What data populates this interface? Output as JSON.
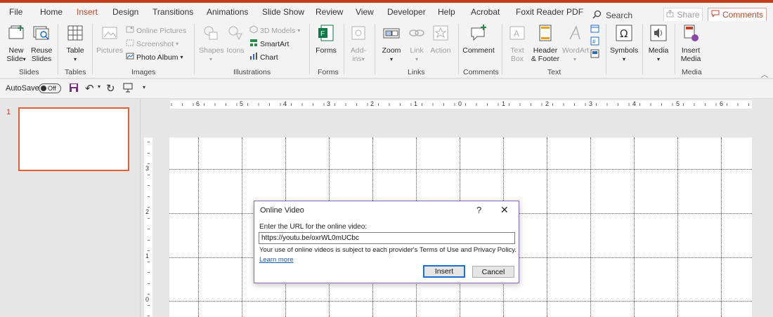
{
  "menu": {
    "tabs": [
      "File",
      "Home",
      "Insert",
      "Design",
      "Transitions",
      "Animations",
      "Slide Show",
      "Review",
      "View",
      "Developer",
      "Help",
      "Acrobat",
      "Foxit Reader PDF"
    ],
    "active_tab": "Insert",
    "search_label": "Search",
    "share_label": "Share",
    "comments_label": "Comments"
  },
  "ribbon": {
    "slides": {
      "new_slide": "New\nSlide",
      "new_slide_arrow": "▾",
      "reuse_slides": "Reuse\nSlides",
      "group": "Slides"
    },
    "tables": {
      "table": "Table",
      "group": "Tables"
    },
    "images": {
      "pictures": "Pictures",
      "online_pictures": "Online Pictures",
      "screenshot": "Screenshot",
      "photo_album": "Photo Album",
      "group": "Images"
    },
    "illustrations": {
      "shapes": "Shapes",
      "icons": "Icons",
      "models_3d": "3D Models",
      "smartart": "SmartArt",
      "chart": "Chart",
      "group": "Illustrations"
    },
    "forms": {
      "forms": "Forms",
      "group": "Forms"
    },
    "addins": {
      "addins": "Add-\nins"
    },
    "links": {
      "zoom": "Zoom",
      "link": "Link",
      "action": "Action",
      "group": "Links"
    },
    "comments": {
      "comment": "Comment",
      "group": "Comments"
    },
    "text": {
      "text_box": "Text\nBox",
      "header_footer": "Header\n& Footer",
      "wordart": "WordArt",
      "group": "Text"
    },
    "symbols": {
      "symbols": "Symbols"
    },
    "media": {
      "media": "Media",
      "insert_media": "Insert\nMedia",
      "group": "Media"
    }
  },
  "qat": {
    "autosave_label": "AutoSave",
    "autosave_state": "Off"
  },
  "thumbnails": {
    "slide_number": "1"
  },
  "rulers": {
    "horizontal": [
      "6",
      "5",
      "4",
      "3",
      "2",
      "1",
      "0",
      "1",
      "2",
      "3",
      "4",
      "5",
      "6"
    ],
    "vertical": [
      "3",
      "2",
      "1",
      "0"
    ]
  },
  "dialog": {
    "title": "Online Video",
    "help": "?",
    "close": "✕",
    "prompt": "Enter the URL for the online video:",
    "url_value": "https://youtu.be/oxrWL0mUCbc",
    "policy_text": "Your use of online videos is subject to each provider's Terms of Use and Privacy Policy.",
    "learn_more": "Learn more",
    "insert_label": "Insert",
    "cancel_label": "Cancel"
  },
  "colors": {
    "accent": "#b7472a",
    "stripe": "#c43e1c",
    "dialog_border": "#8e6bb0",
    "focus_blue": "#1a6fd0"
  }
}
